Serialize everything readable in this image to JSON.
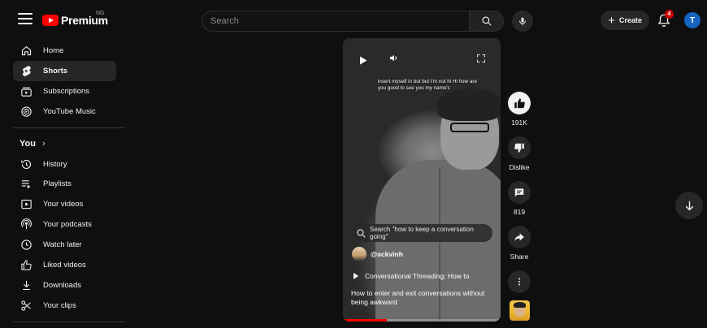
{
  "header": {
    "logo_text": "Premium",
    "country_code": "NG",
    "search_placeholder": "Search",
    "create_label": "Create",
    "notification_count": "4",
    "avatar_letter": "T"
  },
  "sidebar": {
    "main_items": [
      {
        "label": "Home",
        "icon": "home-icon"
      },
      {
        "label": "Shorts",
        "icon": "shorts-icon",
        "active": true
      },
      {
        "label": "Subscriptions",
        "icon": "subscriptions-icon"
      },
      {
        "label": "YouTube Music",
        "icon": "youtube-music-icon"
      }
    ],
    "you_label": "You",
    "you_items": [
      {
        "label": "History",
        "icon": "history-icon"
      },
      {
        "label": "Playlists",
        "icon": "playlists-icon"
      },
      {
        "label": "Your videos",
        "icon": "your-videos-icon"
      },
      {
        "label": "Your podcasts",
        "icon": "podcasts-icon"
      },
      {
        "label": "Watch later",
        "icon": "clock-icon"
      },
      {
        "label": "Liked videos",
        "icon": "thumbs-up-icon"
      },
      {
        "label": "Downloads",
        "icon": "download-icon"
      },
      {
        "label": "Your clips",
        "icon": "scissors-icon"
      }
    ]
  },
  "short": {
    "caption": "insert myself in but but I'm not hi Hi how are you good to see you my name's",
    "search_suggestion": "Search \"how to keep a conversation going\"",
    "channel_handle": "@ackvinh",
    "playlist_title": "Conversational Threading: How to",
    "title": "How to enter and exit conversations without being awkward",
    "progress": 0.28
  },
  "actions": {
    "like_count": "191K",
    "dislike_label": "Dislike",
    "comment_count": "819",
    "share_label": "Share"
  },
  "colors": {
    "brand": "#ff0000",
    "background": "#0f0f0f",
    "surface": "#272727",
    "avatar": "#1565c0",
    "badge": "#cc0000"
  }
}
